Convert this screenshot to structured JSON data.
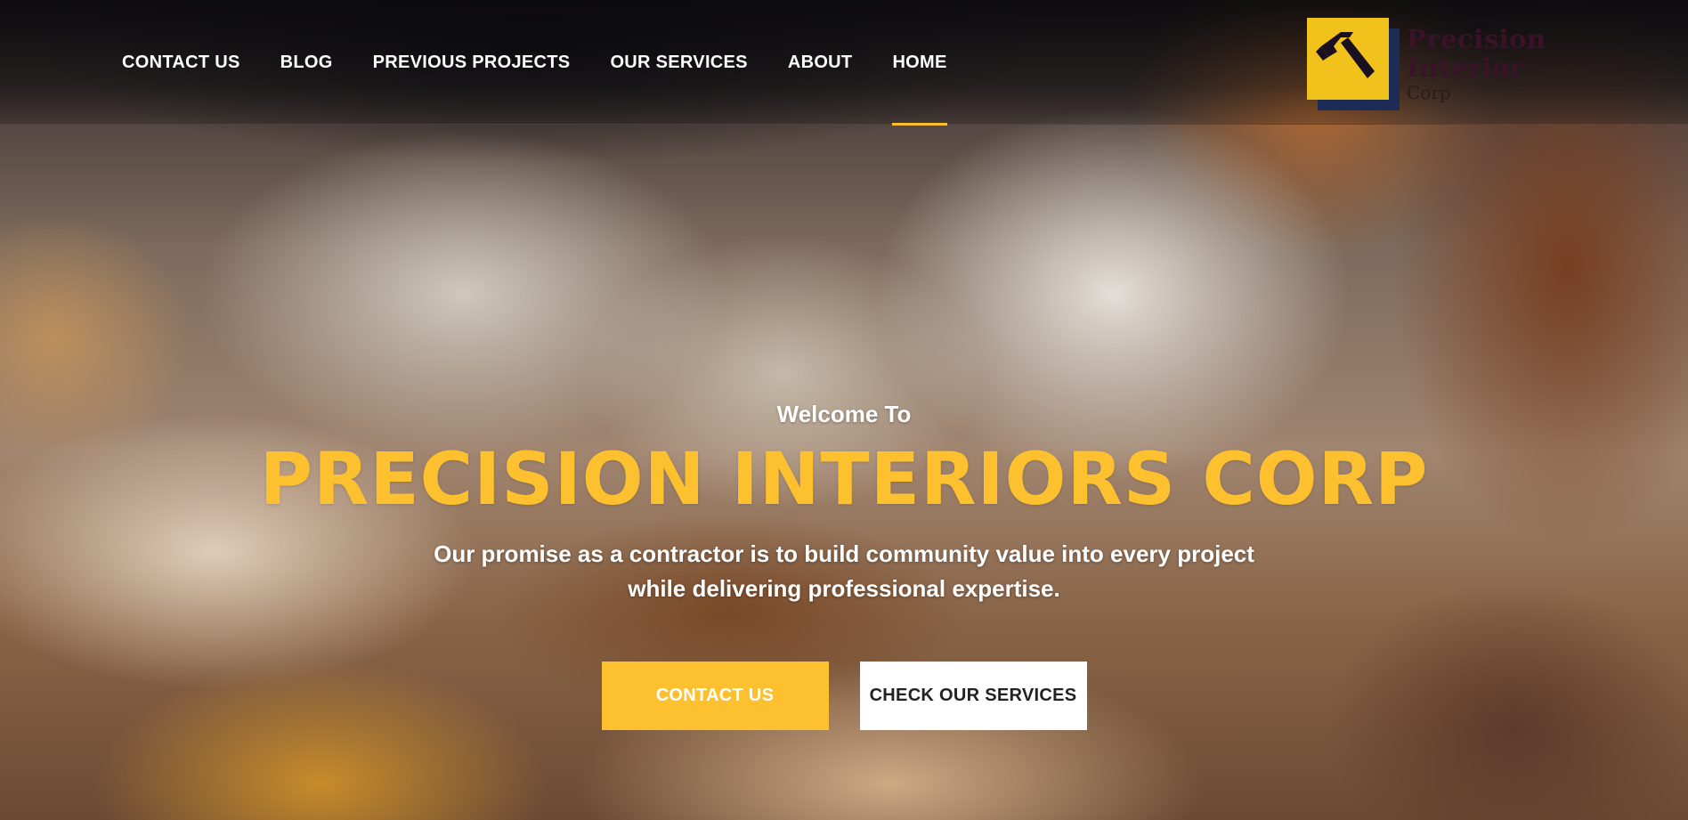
{
  "nav": {
    "items": [
      {
        "label": "CONTACT US"
      },
      {
        "label": "BLOG"
      },
      {
        "label": "PREVIOUS PROJECTS"
      },
      {
        "label": "OUR SERVICES"
      },
      {
        "label": "ABOUT"
      },
      {
        "label": "HOME",
        "active": true
      }
    ]
  },
  "logo": {
    "line1": "Precision",
    "line2": "Interior",
    "line3": "Corp",
    "icon": "hammer-icon"
  },
  "hero": {
    "welcome": "Welcome To",
    "title": "PRECISION INTERIORS CORP",
    "subtitle": "Our promise as a contractor is to build community value into every project while delivering professional expertise."
  },
  "cta": {
    "primary_label": "CONTACT US",
    "secondary_label": "CHECK OUR SERVICES"
  },
  "colors": {
    "accent": "#fdc02f",
    "logo_yellow": "#f1c21b",
    "logo_navy": "#1c2c57",
    "logo_text": "#3a1328"
  }
}
